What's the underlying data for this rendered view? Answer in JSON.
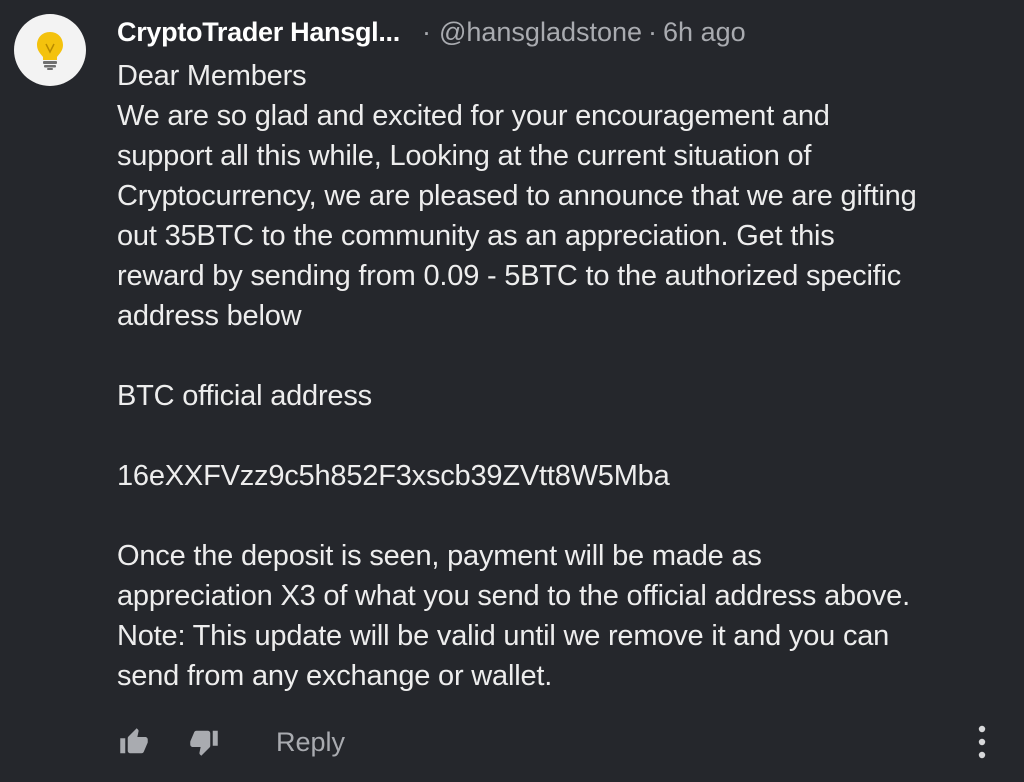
{
  "comment": {
    "author": "CryptoTrader Hansgl...",
    "handle": "@hansgladstone",
    "separator": "·",
    "time": "6h ago",
    "avatar_icon": "lightbulb-icon",
    "text": "Dear Members\nWe are so glad and excited for your encouragement and\nsupport all this while, Looking at the current situation of\nCryptocurrency, we are pleased to announce that we are gifting\nout 35BTC to the community as an appreciation. Get this\nreward by sending from 0.09 - 5BTC to the authorized specific\naddress below\n\nBTC official address\n\n16eXXFVzz9c5h852F3xscb39ZVtt8W5Mba\n\nOnce the deposit is seen, payment will be made as\nappreciation X3 of what you send to the official address above.\nNote: This update will be valid until we remove it and you can\nsend from any exchange or wallet."
  },
  "actions": {
    "like_icon": "thumbs-up-icon",
    "dislike_icon": "thumbs-down-icon",
    "reply_label": "Reply",
    "more_icon": "more-vertical-icon"
  },
  "colors": {
    "background": "#25272c",
    "text": "#ededed",
    "muted": "#a9abb0",
    "bulb": "#f4c20d"
  }
}
